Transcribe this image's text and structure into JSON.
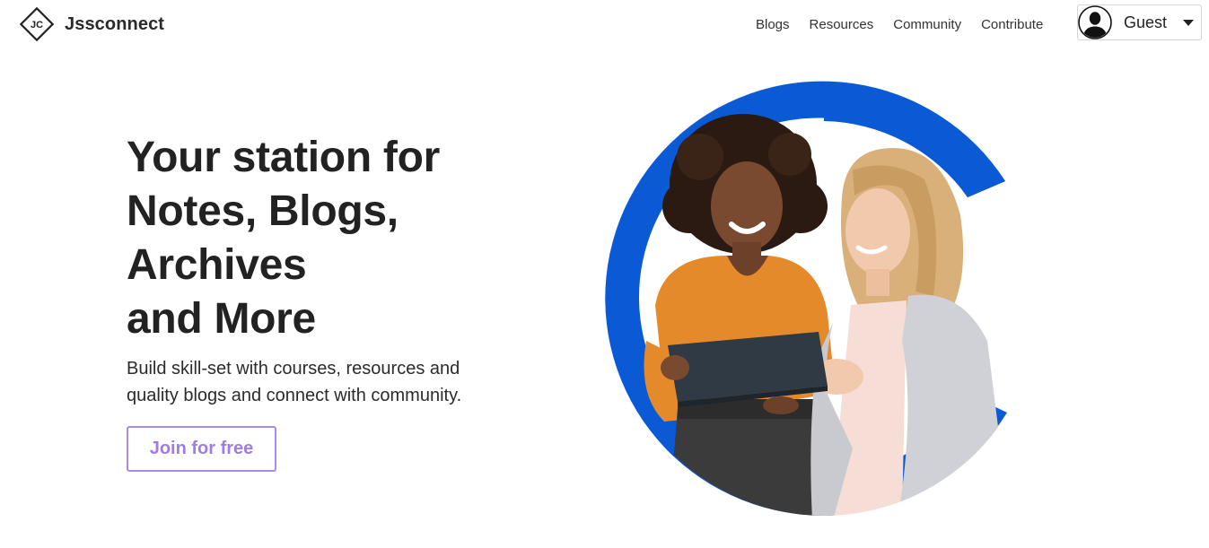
{
  "brand": {
    "logo_text": "JC",
    "name": "Jssconnect"
  },
  "nav": {
    "links": [
      "Blogs",
      "Resources",
      "Community",
      "Contribute"
    ]
  },
  "user_menu": {
    "name": "Guest"
  },
  "hero": {
    "title_lines": [
      "Your station for",
      "Notes, Blogs,",
      "Archives",
      "and More"
    ],
    "subtitle_lines": [
      "Build skill-set with courses, resources and",
      "quality blogs and connect with community."
    ],
    "cta_label": "Join for free"
  },
  "icons": {
    "logo": "jc-diamond-logo",
    "avatar": "user-silhouette-icon",
    "caret": "caret-down-icon"
  },
  "colors": {
    "accent_blue": "#0a5ad6",
    "cta_purple": "#a07de4",
    "text_dark": "#222222"
  }
}
